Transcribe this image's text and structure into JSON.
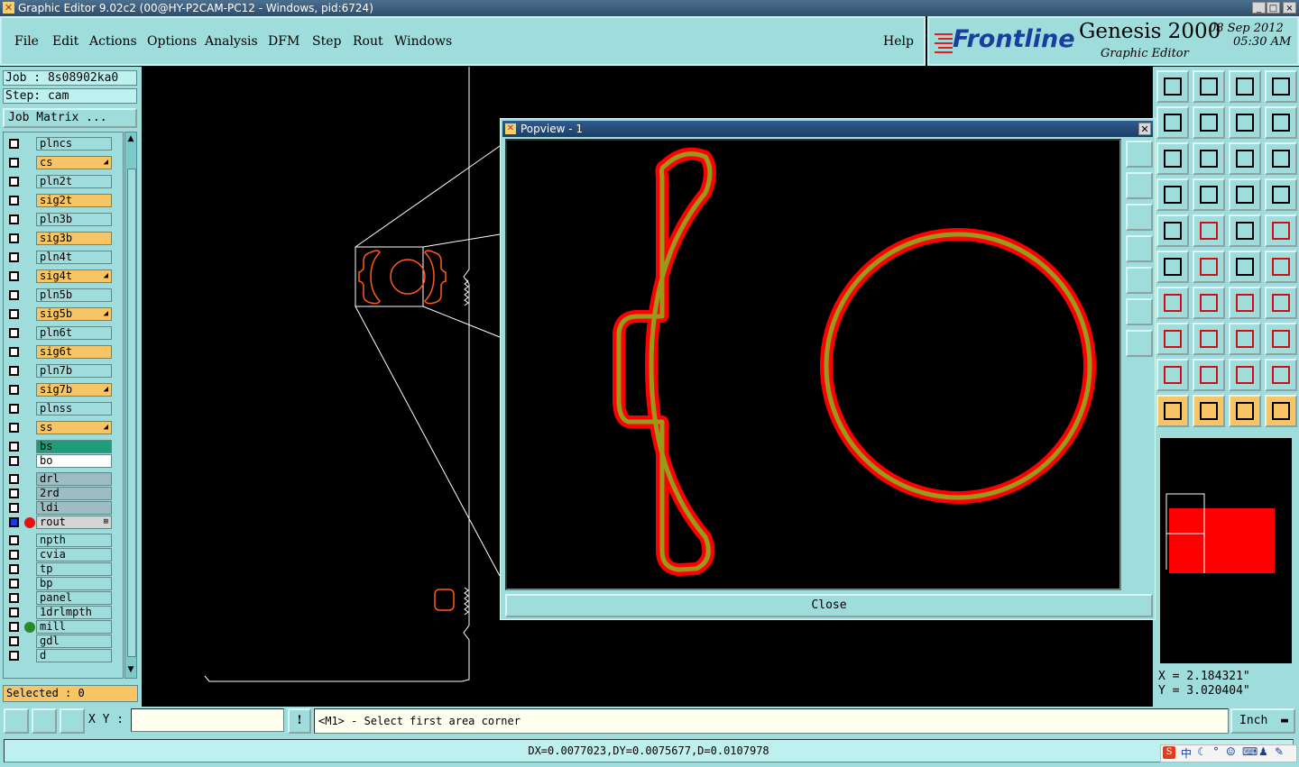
{
  "window": {
    "title": "Graphic Editor 9.02c2 (00@HY-P2CAM-PC12 - Windows, pid:6724)",
    "controls": [
      "_",
      "□",
      "×"
    ]
  },
  "menu": {
    "items": [
      "File",
      "Edit",
      "Actions",
      "Options",
      "Analysis",
      "DFM",
      "Step",
      "Rout",
      "Windows"
    ],
    "help": "Help"
  },
  "brand": {
    "logo": "Frontline",
    "product": "Genesis 2000",
    "subtitle": "Graphic Editor",
    "date": "08 Sep 2012",
    "time": "05:30 AM"
  },
  "job": {
    "job_label": "Job : 8s08902ka0",
    "step_label": "Step: cam",
    "matrix_button": "Job Matrix ..."
  },
  "layers": [
    {
      "name": "plncs",
      "color": "#9fdcdc",
      "flag": ""
    },
    {
      "name": "cs",
      "color": "#f7c565",
      "flag": "◢"
    },
    {
      "name": "pln2t",
      "color": "#9fdcdc",
      "flag": ""
    },
    {
      "name": "sig2t",
      "color": "#f7c565",
      "flag": ""
    },
    {
      "name": "pln3b",
      "color": "#9fdcdc",
      "flag": ""
    },
    {
      "name": "sig3b",
      "color": "#f7c565",
      "flag": ""
    },
    {
      "name": "pln4t",
      "color": "#9fdcdc",
      "flag": ""
    },
    {
      "name": "sig4t",
      "color": "#f7c565",
      "flag": "◢"
    },
    {
      "name": "pln5b",
      "color": "#9fdcdc",
      "flag": ""
    },
    {
      "name": "sig5b",
      "color": "#f7c565",
      "flag": "◢"
    },
    {
      "name": "pln6t",
      "color": "#9fdcdc",
      "flag": ""
    },
    {
      "name": "sig6t",
      "color": "#f7c565",
      "flag": ""
    },
    {
      "name": "pln7b",
      "color": "#9fdcdc",
      "flag": ""
    },
    {
      "name": "sig7b",
      "color": "#f7c565",
      "flag": "◢"
    },
    {
      "name": "plnss",
      "color": "#9fdcdc",
      "flag": ""
    },
    {
      "name": "ss",
      "color": "#f7c565",
      "flag": "◢"
    },
    {
      "name": "bs",
      "color": "#1e9e78",
      "flag": ""
    },
    {
      "name": "bo",
      "color": "#ffffff",
      "flag": ""
    },
    {
      "name": "drl",
      "color": "#9fbcc4",
      "flag": ""
    },
    {
      "name": "2rd",
      "color": "#9fbcc4",
      "flag": ""
    },
    {
      "name": "ldi",
      "color": "#9fbcc4",
      "flag": ""
    },
    {
      "name": "rout",
      "color": "#d4d4d4",
      "flag": "⊞"
    },
    {
      "name": "npth",
      "color": "#9fdcdc",
      "flag": ""
    },
    {
      "name": "cvia",
      "color": "#9fdcdc",
      "flag": ""
    },
    {
      "name": "tp",
      "color": "#9fdcdc",
      "flag": ""
    },
    {
      "name": "bp",
      "color": "#9fdcdc",
      "flag": ""
    },
    {
      "name": "panel",
      "color": "#9fdcdc",
      "flag": ""
    },
    {
      "name": "1drlmpth",
      "color": "#9fdcdc",
      "flag": ""
    },
    {
      "name": "mill",
      "color": "#9fdcdc",
      "flag": ""
    },
    {
      "name": "gdl",
      "color": "#9fdcdc",
      "flag": ""
    },
    {
      "name": "d",
      "color": "#9fdcdc",
      "flag": ""
    }
  ],
  "selected_count": "Selected : 0",
  "popup": {
    "title": "Popview - 1",
    "close_label": "Close"
  },
  "coords": {
    "x": "X = 2.184321\"",
    "y": "Y = 3.020404\""
  },
  "bottom": {
    "xy_label": "X Y :",
    "xy_value": "",
    "alert": "!",
    "prompt": "<M1> - Select first area corner",
    "units": "Inch"
  },
  "status": {
    "measure": "DX=0.0077023,DY=0.0075677,D=0.0107978"
  },
  "colors": {
    "panel": "#9fdcdc",
    "board_outline": "#ffffff",
    "feature_red": "#ff0000",
    "feature_olive": "#9a9a1a",
    "layer_orange": "#f7c565"
  }
}
